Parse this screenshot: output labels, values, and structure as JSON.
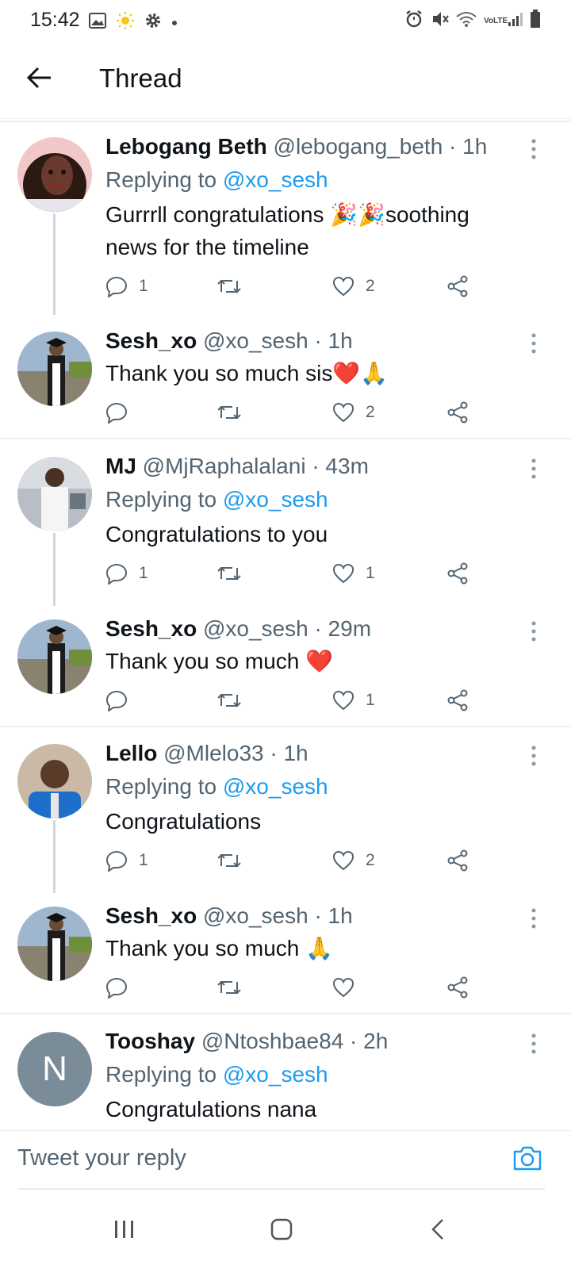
{
  "status_bar": {
    "time": "15:42",
    "left_icons": [
      "image-icon",
      "sun-icon",
      "gear-icon",
      "dot-icon"
    ],
    "right_icons": [
      "alarm-icon",
      "vibrate-icon",
      "wifi-icon",
      "volte-icon",
      "signal-icon",
      "battery-icon"
    ],
    "volte_label": "VoLTE"
  },
  "header": {
    "title": "Thread"
  },
  "tweets": [
    {
      "name": "Lebogang Beth",
      "meta": " @lebogang_beth · 1h",
      "replying_prefix": "Replying to ",
      "replying_to": "@xo_sesh",
      "text": "Gurrrll congratulations 🎉🎉soothing news for the timeline",
      "replies": "1",
      "retweets": "",
      "likes": "2",
      "avatar_color": "#6b3a2e"
    },
    {
      "name": "Sesh_xo",
      "meta": " @xo_sesh · 1h",
      "text": "Thank you so much sis❤️🙏",
      "replies": "",
      "retweets": "",
      "likes": "2",
      "avatar_color": "#7a8a99"
    },
    {
      "name": "MJ",
      "meta": " @MjRaphalalani · 43m",
      "replying_prefix": "Replying to ",
      "replying_to": "@xo_sesh",
      "text": "Congratulations to you",
      "replies": "1",
      "retweets": "",
      "likes": "1",
      "avatar_color": "#c9cfd6"
    },
    {
      "name": "Sesh_xo",
      "meta": " @xo_sesh · 29m",
      "text": "Thank you so much ❤️",
      "replies": "",
      "retweets": "",
      "likes": "1",
      "avatar_color": "#7a8a99"
    },
    {
      "name": "Lello",
      "meta": " @Mlelo33 · 1h",
      "replying_prefix": "Replying to ",
      "replying_to": "@xo_sesh",
      "text": "Congratulations",
      "replies": "1",
      "retweets": "",
      "likes": "2",
      "avatar_color": "#8a6a4f"
    },
    {
      "name": "Sesh_xo",
      "meta": " @xo_sesh · 1h",
      "text": "Thank you so much 🙏",
      "replies": "",
      "retweets": "",
      "likes": "",
      "avatar_color": "#7a8a99"
    },
    {
      "name": "Tooshay",
      "meta": " @Ntoshbae84 · 2h",
      "replying_prefix": "Replying to ",
      "replying_to": "@xo_sesh",
      "text": "Congratulations nana",
      "avatar_letter": "N",
      "avatar_color": "#7b8c99"
    }
  ],
  "reply_bar": {
    "placeholder": "Tweet your reply",
    "camera_icon": "camera-icon"
  },
  "nav_bar": {
    "icons": [
      "recent-apps-icon",
      "home-icon",
      "back-icon"
    ]
  },
  "colors": {
    "accent": "#1d9bf0",
    "secondary_text": "#536471",
    "primary_text": "#0f1419",
    "divider": "#eceff1",
    "thread_line": "#cfd9de"
  }
}
